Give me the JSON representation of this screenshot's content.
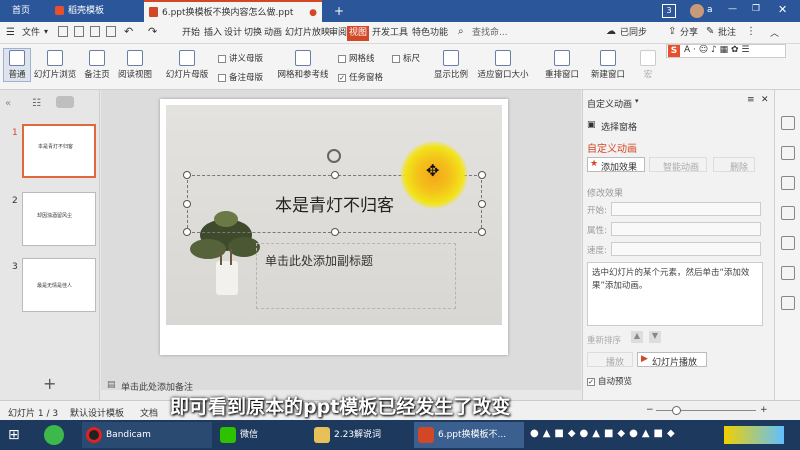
{
  "tabs": {
    "home": "首页",
    "daoke": "稻壳模板",
    "doc": "6.ppt换模板不换内容怎么做.ppt",
    "add": "+",
    "tab_count": "3",
    "user": "a"
  },
  "menubar": {
    "file": "文件",
    "items": [
      "开始",
      "插入",
      "设计",
      "切换",
      "动画",
      "幻灯片放映",
      "审阅",
      "视图",
      "开发工具",
      "特色功能"
    ],
    "active_index": 7,
    "search": "查找命...",
    "sync": "已同步",
    "share": "分享",
    "comment": "批注"
  },
  "ribbon": {
    "normal": "普通",
    "slide_browse": "幻灯片浏览",
    "notes_page": "备注页",
    "reading_view": "阅读视图",
    "slide_master": "幻灯片母版",
    "handout_master": "讲义母版",
    "notes_master": "备注母版",
    "grid_guides": "网格和参考线",
    "gridlines": "网格线",
    "ruler": "标尺",
    "task_pane": "任务窗格",
    "zoom": "显示比例",
    "fit_window": "适应窗口大小",
    "arrange": "重排窗口",
    "new_window": "新建窗口",
    "macro": "宏"
  },
  "slides": [
    {
      "num": "1",
      "title": "本是青灯不归客"
    },
    {
      "num": "2",
      "title": "却因浊酒留风尘"
    },
    {
      "num": "3",
      "title": "最是无情是佳人"
    }
  ],
  "slide": {
    "title": "本是青灯不归客",
    "subtitle_placeholder": "单击此处添加副标题"
  },
  "notes_placeholder": "单击此处添加备注",
  "anim_panel": {
    "header": "自定义动画",
    "select_pane": "选择窗格",
    "custom_anim": "自定义动画",
    "add_effect": "添加效果",
    "smart_anim": "智能动画",
    "delete": "删除",
    "modify_effect": "修改效果",
    "start": "开始:",
    "property": "属性:",
    "speed": "速度:",
    "hint": "选中幻灯片的某个元素，然后单击“添加效果”添加动画。",
    "reorder": "重新排序",
    "play": "播放",
    "slideshow": "幻灯片播放",
    "auto_preview": "自动预览"
  },
  "statusbar": {
    "slide_info": "幻灯片 1 / 3",
    "design_template": "默认设计模板",
    "doc": "文档"
  },
  "subtitle_caption": "即可看到原本的ppt模板已经发生了改变",
  "taskbar": {
    "bandicam": "Bandicam",
    "wechat": "微信",
    "folder": "2.23解说词",
    "wps": "6.ppt换模板不..."
  },
  "colors": {
    "accent": "#d24726",
    "titlebar": "#2b579a",
    "taskbar": "#1d3a5e"
  }
}
